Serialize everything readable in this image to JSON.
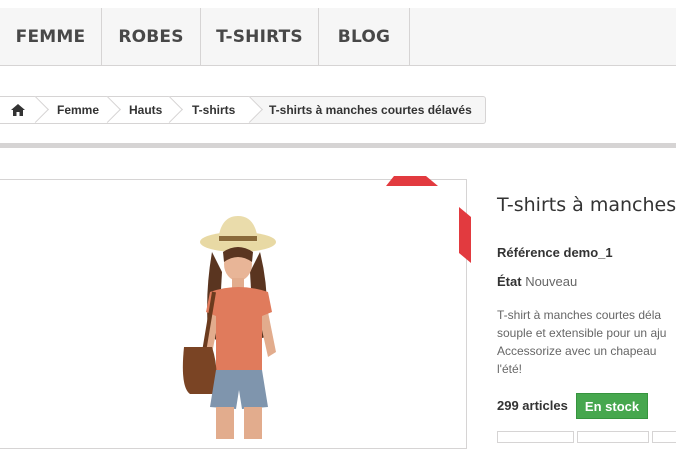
{
  "nav": {
    "items": [
      {
        "label": "FEMME"
      },
      {
        "label": "ROBES"
      },
      {
        "label": "T-SHIRTS"
      },
      {
        "label": "BLOG"
      }
    ]
  },
  "breadcrumb": {
    "home_icon": "home-icon",
    "items": [
      {
        "label": "Femme"
      },
      {
        "label": "Hauts"
      },
      {
        "label": "T-shirts"
      }
    ],
    "current": "T-shirts à manches courtes délavés"
  },
  "product": {
    "title": "T-shirts à manches c",
    "reference_label": "Référence",
    "reference_value": "demo_1",
    "condition_label": "État",
    "condition_value": "Nouveau",
    "description_lines": [
      "T-shirt à manches courtes déla",
      "souple et extensible pour un aju",
      "Accessorize avec un chapeau",
      "l'été!"
    ],
    "quantity": "299 articles",
    "stock_badge": "En stock"
  },
  "colors": {
    "ribbon": "#e23a3f",
    "stock": "#46a74e"
  }
}
